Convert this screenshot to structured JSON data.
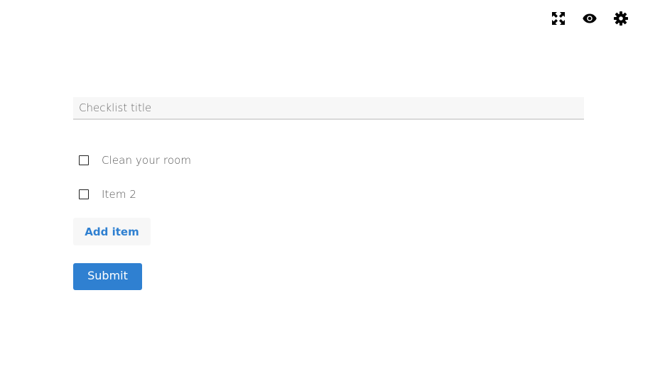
{
  "toolbar": {
    "icons": [
      "expand-icon",
      "eye-icon",
      "gear-icon"
    ]
  },
  "form": {
    "title_placeholder": "Checklist title",
    "title_value": "",
    "items": [
      {
        "label": "Clean your room",
        "checked": false
      },
      {
        "label": "Item 2",
        "checked": false
      }
    ],
    "add_item_label": "Add item",
    "submit_label": "Submit"
  },
  "colors": {
    "accent": "#2f80d1",
    "field_bg": "#f7f7f7",
    "field_border": "#d9d9d9"
  }
}
